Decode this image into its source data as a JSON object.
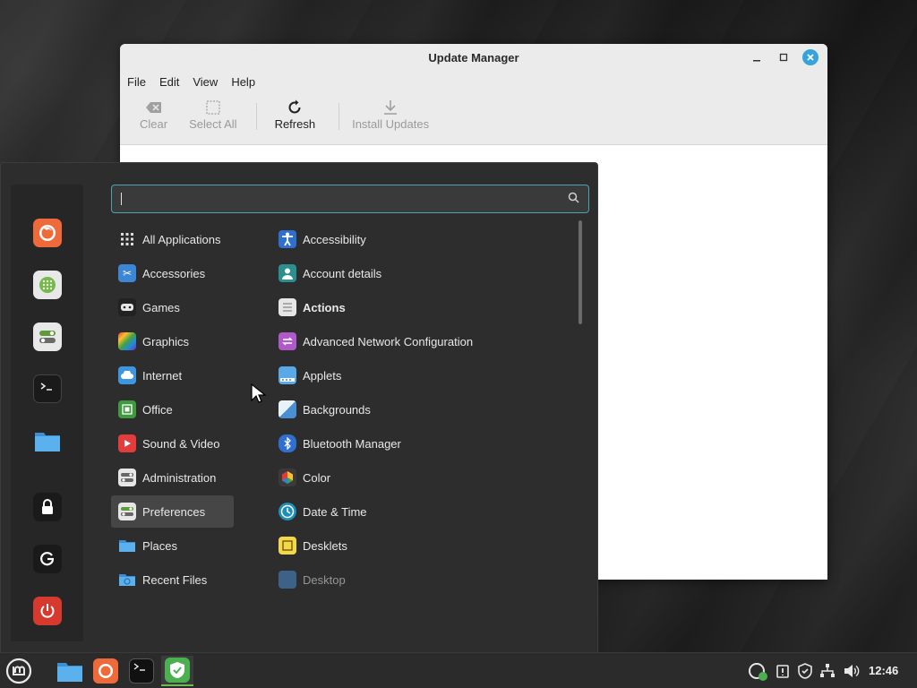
{
  "window": {
    "title": "Update Manager",
    "menus": [
      "File",
      "Edit",
      "View",
      "Help"
    ],
    "toolbar": {
      "clear_label": "Clear",
      "select_all_label": "Select All",
      "refresh_label": "Refresh",
      "install_label": "Install Updates"
    }
  },
  "menu": {
    "search": {
      "value": "",
      "placeholder": ""
    },
    "favorites": [
      "firefox-icon",
      "software-manager-icon",
      "settings-icon",
      "terminal-icon",
      "files-icon",
      "lock-icon",
      "logout-icon",
      "power-icon"
    ],
    "categories": [
      "All Applications",
      "Accessories",
      "Games",
      "Graphics",
      "Internet",
      "Office",
      "Sound & Video",
      "Administration",
      "Preferences",
      "Places",
      "Recent Files"
    ],
    "selected_category": "Preferences",
    "apps": [
      "Accessibility",
      "Account details",
      "Actions",
      "Advanced Network Configuration",
      "Applets",
      "Backgrounds",
      "Bluetooth Manager",
      "Color",
      "Date & Time",
      "Desklets",
      "Desktop"
    ]
  },
  "taskbar": {
    "clock": "12:46"
  },
  "colors": {
    "accent": "#35a4dd",
    "menu_bg": "#2d2d2d",
    "search_border": "#4ba3b3"
  }
}
